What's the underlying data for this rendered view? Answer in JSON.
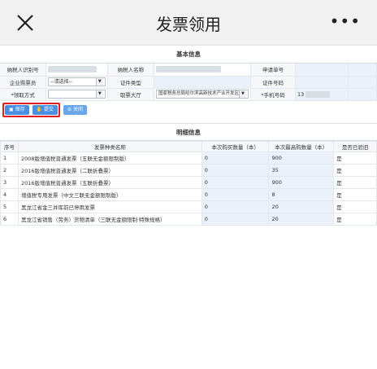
{
  "header": {
    "title": "发票领用",
    "more": "•••"
  },
  "basic": {
    "section_title": "基本信息",
    "taxpayer_id_label": "纳税人识别号",
    "taxpayer_name_label": "纳税人名称",
    "apply_no_label": "申请单号",
    "buyer_label": "企业购票员",
    "buyer_select": "--请选择--",
    "cert_type_label": "证件类型",
    "cert_no_label": "证件号码",
    "pickup_label": "*领取方式",
    "pickup_select": "",
    "hall_label": "取票大厅",
    "hall_select": "国家税务总局哈尔滨高新技术产业开发区",
    "phone_label": "*手机号码",
    "phone_value": "13"
  },
  "toolbar": {
    "save": "保存",
    "submit": "提交",
    "close": "关闭"
  },
  "detail": {
    "section_title": "明细信息",
    "headers": [
      "序号",
      "发票种类名称",
      "本次购买数量（本）",
      "本次最高购数量（本）",
      "是否已验旧"
    ],
    "rows": [
      {
        "no": "1",
        "name": "2008版增值税普通发票（五联无金额限制版）",
        "qty": "0",
        "max": "900",
        "checked": "是"
      },
      {
        "no": "2",
        "name": "2016版增值税普通发票（二联折叠票）",
        "qty": "0",
        "max": "35",
        "checked": "是"
      },
      {
        "no": "3",
        "name": "2016版增值税普通发票（五联折叠票）",
        "qty": "0",
        "max": "900",
        "checked": "是"
      },
      {
        "no": "4",
        "name": "增值税专用发票（中文三联无金额限制版）",
        "qty": "0",
        "max": "8",
        "checked": "是"
      },
      {
        "no": "5",
        "name": "黑龙江省金三并库前已停用发票",
        "qty": "0",
        "max": "20",
        "checked": "是"
      },
      {
        "no": "6",
        "name": "黑龙江省销售（劳务）货物清单（三联无金额限制·特殊规格）",
        "qty": "0",
        "max": "20",
        "checked": "是"
      }
    ]
  }
}
